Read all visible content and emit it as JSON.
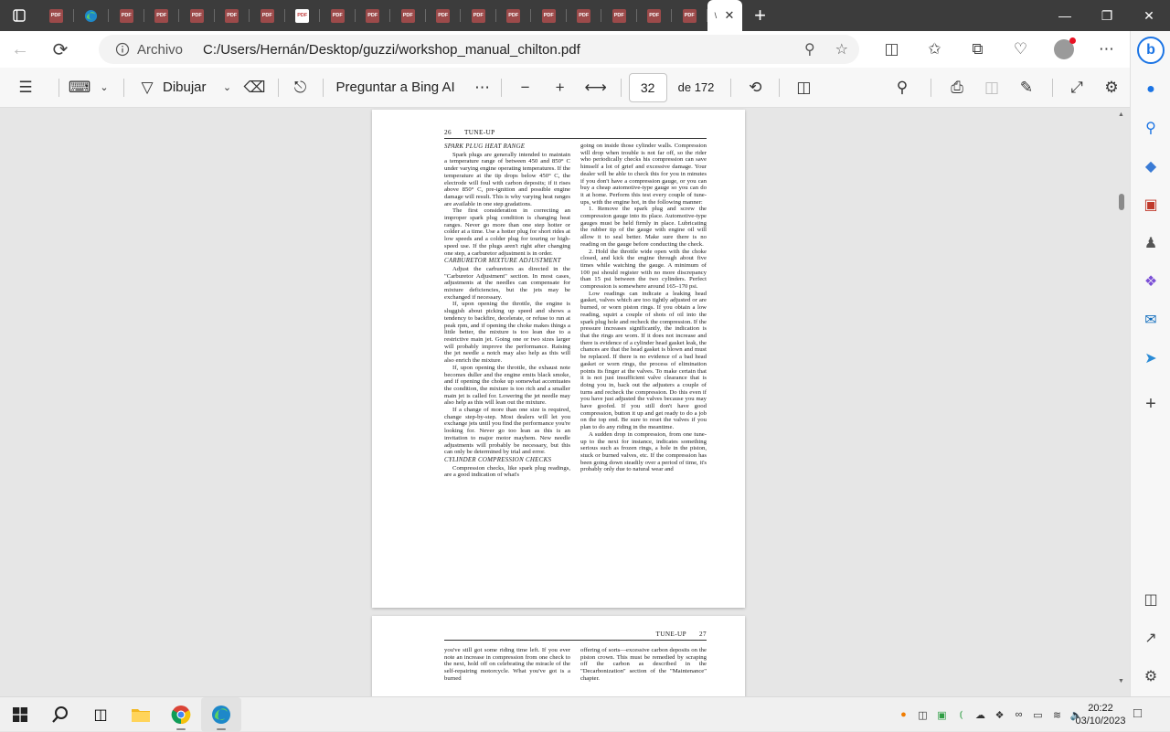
{
  "browser": {
    "tabs_count": 20,
    "active_tab_label": "\\",
    "pdf_icon_label": "PDF",
    "url_prefix": "Archivo",
    "url": "C:/Users/Hernán/Desktop/guzzi/workshop_manual_chilton.pdf"
  },
  "toolbar": {
    "draw_label": "Dibujar",
    "ask_bing_label": "Preguntar a Bing AI",
    "page_current": "32",
    "page_total": "de 172"
  },
  "page1": {
    "number": "26",
    "section": "TUNE-UP",
    "left_column": [
      {
        "type": "heading",
        "text": "SPARK PLUG HEAT RANGE"
      },
      {
        "type": "p",
        "text": "Spark plugs are generally intended to maintain a temperature range of between 450 and 850° C under varying engine operating temperatures. If the temperature at the tip drops below 450° C, the electrode will foul with carbon deposits; if it rises above 850° C, pre-ignition and possible engine damage will result. This is why varying heat ranges are available in one step gradations."
      },
      {
        "type": "p",
        "text": "The first consideration in correcting an improper spark plug condition is changing heat ranges. Never go more than one step hotter or colder at a time. Use a hotter plug for short rides at low speeds and a colder plug for touring or high-speed use. If the plugs aren't right after changing one step, a carburetor adjustment is in order."
      },
      {
        "type": "heading",
        "text": "CARBURETOR MIXTURE ADJUSTMENT"
      },
      {
        "type": "p",
        "text": "Adjust the carburetors as directed in the \"Carburetor Adjustment\" section. In most cases, adjustments at the needles can compensate for mixture deficiencies, but the jets may be exchanged if necessary."
      },
      {
        "type": "p",
        "text": "If, upon opening the throttle, the engine is sluggish about picking up speed and shows a tendency to backfire, decelerate, or refuse to run at peak rpm, and if opening the choke makes things a little better, the mixture is too lean due to a restrictive main jet. Going one or two sizes larger will probably improve the performance. Raising the jet needle a notch may also help as this will also enrich the mixture."
      },
      {
        "type": "p",
        "text": "If, upon opening the throttle, the exhaust note becomes duller and the engine emits black smoke, and if opening the choke up somewhat accentuates the condition, the mixture is too rich and a smaller main jet is called for. Lowering the jet needle may also help as this will lean out the mixture."
      },
      {
        "type": "p",
        "text": "If a change of more than one size is required, change step-by-step. Most dealers will let you exchange jets until you find the performance you're looking for. Never go too lean as this is an invitation to major motor mayhem. New needle adjustments will probably be necessary, but this can only be determined by trial and error."
      },
      {
        "type": "heading",
        "text": "CYLINDER COMPRESSION CHECKS"
      },
      {
        "type": "p",
        "text": "Compression checks, like spark plug readings, are a good indication of what's"
      }
    ],
    "right_column": [
      {
        "type": "c",
        "text": "going on inside those cylinder walls. Compression will drop when trouble is not far off, so the rider who periodically checks his compression can save himself a lot of grief and excessive damage. Your dealer will be able to check this for you in minutes if you don't have a compression gauge, or you can buy a cheap automotive-type gauge so you can do it at home. Perform this test every couple of tune-ups, with the engine hot, in the following manner:"
      },
      {
        "type": "p",
        "text": "1. Remove the spark plug and screw the compression gauge into its place. Automotive-type gauges must be held firmly in place. Lubricating the rubber tip of the gauge with engine oil will allow it to seal better. Make sure there is no reading on the gauge before conducting the check."
      },
      {
        "type": "p",
        "text": "2. Hold the throttle wide open with the choke closed, and kick the engine through about five times while watching the gauge. A minimum of 100 psi should register with no more discrepancy than 15 psi between the two cylinders. Perfect compression is somewhere around 165–170 psi."
      },
      {
        "type": "p",
        "text": "Low readings can indicate a leaking head gasket, valves which are too tightly adjusted or are burned, or worn piston rings. If you obtain a low reading, squirt a couple of shots of oil into the spark plug hole and recheck the compression. If the pressure increases significantly, the indication is that the rings are worn. If it does not increase and there is evidence of a cylinder head gasket leak, the chances are that the head gasket is blown and must be replaced. If there is no evidence of a bad head gasket or worn rings, the process of elimination points its finger at the valves. To make certain that it is not just insufficient valve clearance that is doing you in, back out the adjusters a couple of turns and recheck the compression. Do this even if you have just adjusted the valves because you may have goofed. If you still don't have good compression, button it up and get ready to do a job on the top end. Be sure to reset the valves if you plan to do any riding in the meantime."
      },
      {
        "type": "p",
        "text": "A sudden drop in compression, from one tune-up to the next for instance, indicates something serious such as frozen rings, a hole in the piston, stuck or burned valves, etc. If the compression has been going down steadily over a period of time, it's probably only due to natural wear and"
      }
    ]
  },
  "page2": {
    "section": "TUNE-UP",
    "number": "27",
    "left_text": "you've still got some riding time left. If you ever note an increase in compression from one check to the next, hold off on celebrating the miracle of the self-repairing motorcycle. What you've got is a burned",
    "right_text": "offering of sorts—excessive carbon deposits on the piston crown. This must be remedied by scraping off the carbon as described in the \"Decarbonization\" section of the \"Maintenance\" chapter."
  },
  "taskbar": {
    "time": "20:22",
    "date": "03/10/2023"
  },
  "colors": {
    "titlebar": "#3c3c3c",
    "accent_blue": "#0f6cbd",
    "pdf_red": "#c23b3b"
  }
}
